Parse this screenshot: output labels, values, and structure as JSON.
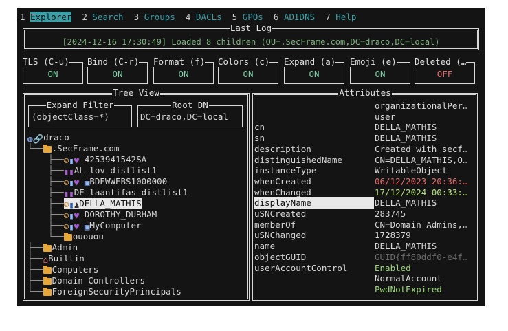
{
  "tabs": [
    {
      "num": "1",
      "label": "Explorer",
      "active": true
    },
    {
      "num": "2",
      "label": "Search",
      "active": false
    },
    {
      "num": "3",
      "label": "Groups",
      "active": false
    },
    {
      "num": "4",
      "label": "DACLs",
      "active": false
    },
    {
      "num": "5",
      "label": "GPOs",
      "active": false
    },
    {
      "num": "6",
      "label": "ADIDNS",
      "active": false
    },
    {
      "num": "7",
      "label": "Help",
      "active": false
    }
  ],
  "last_log": {
    "title": "Last Log",
    "message": "[2024-12-16 17:30:49] Loaded 8 children (OU=.SecFrame.com,DC=draco,DC=local)"
  },
  "toggles": [
    {
      "title": "TLS (C-u)",
      "value": "ON"
    },
    {
      "title": "Bind (C-r)",
      "value": "ON"
    },
    {
      "title": "Format (f)",
      "value": "ON"
    },
    {
      "title": "Colors (c)",
      "value": "ON"
    },
    {
      "title": "Expand (a)",
      "value": "ON"
    },
    {
      "title": "Emoji (e)",
      "value": "ON"
    },
    {
      "title": "Deleted (…",
      "value": "OFF"
    }
  ],
  "tree_view": {
    "title": "Tree View",
    "expand_filter_title": "Expand Filter",
    "expand_filter_value": "(objectClass=*)",
    "root_dn_title": "Root DN",
    "root_dn_value": "DC=draco,DC=local",
    "root": "draco",
    "nodes": [
      ".SecFrame.com",
      "4253941542SA",
      "AL-lov-distlist1",
      "BDEWWEBS1000000",
      "DE-laantifas-distlist1",
      "DELLA_MATHIS",
      "DOROTHY_DURHAM",
      "MyComputer",
      "ououou",
      "Admin",
      "Builtin",
      "Computers",
      "Domain Controllers",
      "ForeignSecurityPrincipals"
    ]
  },
  "attributes": {
    "title": "Attributes",
    "class_values": [
      "organizationalPer…",
      "user"
    ],
    "rows": [
      {
        "key": "cn",
        "value": "DELLA_MATHIS"
      },
      {
        "key": "sn",
        "value": "DELLA_MATHIS"
      },
      {
        "key": "description",
        "value": "Created with secf…"
      },
      {
        "key": "distinguishedName",
        "value": "CN=DELLA_MATHIS,O…"
      },
      {
        "key": "instanceType",
        "value": "WritableObject"
      },
      {
        "key": "whenCreated",
        "value": "06/12/2023 20:36:…"
      },
      {
        "key": "whenChanged",
        "value": "17/12/2024 00:33:…"
      },
      {
        "key": "displayName",
        "value": "DELLA_MATHIS"
      },
      {
        "key": "uSNCreated",
        "value": "283745"
      },
      {
        "key": "memberOf",
        "value": "CN=Domain Admins,…"
      },
      {
        "key": "uSNChanged",
        "value": "1728379"
      },
      {
        "key": "name",
        "value": "DELLA_MATHIS"
      },
      {
        "key": "objectGUID",
        "value": "GUID{ff80ddf0-e4f…"
      },
      {
        "key": "userAccountControl",
        "value": "Enabled"
      }
    ],
    "uac_extra": [
      "NormalAccount",
      "PwdNotExpired"
    ]
  },
  "colors": {
    "accent": "#3aa0a8",
    "on": "#7fd1a8",
    "off": "#e36a6a",
    "created": "#e36a6a",
    "changed": "#b5e07a"
  }
}
